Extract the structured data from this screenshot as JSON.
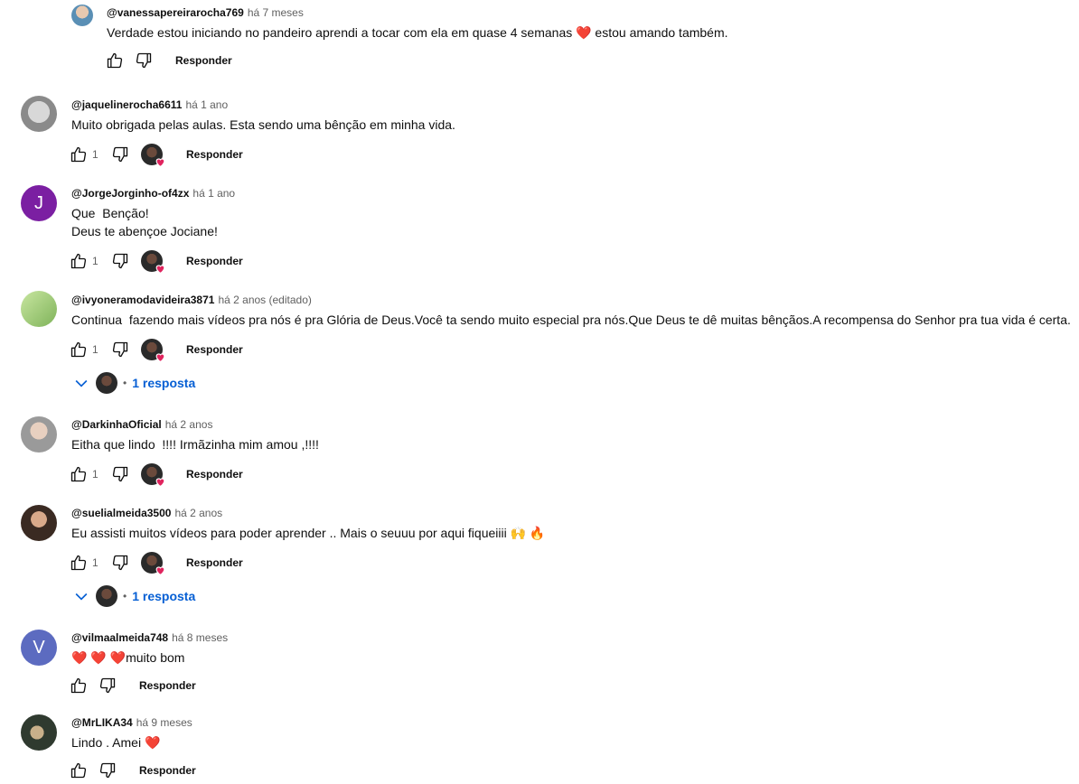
{
  "colors": {
    "link": "#065fd4",
    "meta": "#606060",
    "heart": "#e0245e"
  },
  "labels": {
    "reply": "Responder"
  },
  "comments": [
    {
      "author": "@vanessapereirarocha769",
      "time": "há 7 meses",
      "line1": "Verdade estou iniciando no pandeiro aprendi a tocar com ela em quase 4 semanas ❤️ estou amando também.",
      "likes": ""
    },
    {
      "author": "@jaquelinerocha6611",
      "time": "há 1 ano",
      "line1": "Muito obrigada pelas aulas. Esta sendo uma bênção em minha vida.",
      "likes": "1"
    },
    {
      "author": "@JorgeJorginho-of4zx",
      "time": "há 1 ano",
      "line1": "Que  Benção!",
      "line2": "Deus te abençoe Jociane!",
      "likes": "1",
      "avatar_letter": "J"
    },
    {
      "author": "@ivyoneramodavideira3871",
      "time": "há 2 anos (editado)",
      "line1": "Continua  fazendo mais vídeos pra nós é pra Glória de Deus.Você ta sendo muito especial pra nós.Que Deus te dê muitas bênçãos.A recompensa do Senhor pra tua vida é certa.",
      "likes": "1",
      "replies": "1 resposta"
    },
    {
      "author": "@DarkinhaOficial",
      "time": "há 2 anos",
      "line1": "Eitha que lindo  !!!! Irmãzinha mim amou ,!!!!",
      "likes": "1"
    },
    {
      "author": "@suelialmeida3500",
      "time": "há 2 anos",
      "line1": "Eu assisti muitos vídeos para poder aprender .. Mais o seuuu por aqui fiqueiiii 🙌 🔥",
      "likes": "1",
      "replies": "1 resposta"
    },
    {
      "author": "@vilmaalmeida748",
      "time": "há 8 meses",
      "line1": "❤️ ❤️ ❤️muito bom",
      "likes": "",
      "avatar_letter": "V"
    },
    {
      "author": "@MrLIKA34",
      "time": "há 9 meses",
      "line1": "Lindo . Amei ❤️",
      "likes": ""
    }
  ]
}
